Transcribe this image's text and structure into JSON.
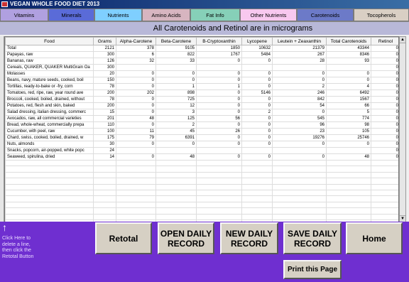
{
  "window": {
    "title": "VEGAN WHOLE FOOD DIET 2013"
  },
  "tabs": [
    {
      "label": "Vitamins",
      "color": "#b0a0e0"
    },
    {
      "label": "Minerals",
      "color": "#5a6bd8"
    },
    {
      "label": "Nutrients",
      "color": "#7fcfff"
    },
    {
      "label": "Amino Acids",
      "color": "#d7b5c0"
    },
    {
      "label": "Fat Info",
      "color": "#86d0b8"
    },
    {
      "label": "Other Nutrients",
      "color": "#f8c8ef"
    },
    {
      "label": "Carotenoids",
      "color": "#6c7ac8"
    },
    {
      "label": "Tocopherols",
      "color": "#d9cfc4"
    }
  ],
  "panel": {
    "heading": "All Carotenoids and Retinol are in micrograms"
  },
  "table": {
    "columns": [
      "Food",
      "Grams",
      "Alpha-Carotene",
      "Beta-Carotene",
      "B-Cryptoxanthin",
      "Lycopene",
      "Leutein + Zeaxanthin",
      "Total Carotenoids",
      "Retinol"
    ],
    "rows": [
      [
        "Total",
        "2121",
        "378",
        "9105",
        "1850",
        "10632",
        "21379",
        "43344",
        "0"
      ],
      [
        "Papayas, raw",
        "300",
        "6",
        "822",
        "1767",
        "5484",
        "267",
        "8346",
        "0"
      ],
      [
        "Bananas, raw",
        "126",
        "32",
        "33",
        "0",
        "0",
        "28",
        "93",
        "0"
      ],
      [
        "Cereals, QUAKER, QUAKER MultiGrain Oa",
        "300",
        "",
        "",
        "",
        "",
        "",
        "",
        "0"
      ],
      [
        "Molasses",
        "20",
        "0",
        "0",
        "0",
        "0",
        "0",
        "0",
        "0"
      ],
      [
        "Beans, navy, mature seeds, cooked, boil",
        "150",
        "0",
        "0",
        "0",
        "0",
        "0",
        "0",
        "0"
      ],
      [
        "Tortillas, ready-to-bake or -fry, corn",
        "78",
        "0",
        "1",
        "1",
        "0",
        "2",
        "4",
        "0"
      ],
      [
        "Tomatoes, red, ripe, raw, year round ave",
        "200",
        "202",
        "898",
        "0",
        "5146",
        "246",
        "6492",
        "0"
      ],
      [
        "Broccoli, cooked, boiled, drained, without",
        "78",
        "0",
        "725",
        "0",
        "0",
        "842",
        "1567",
        "0"
      ],
      [
        "Potatoes, red, flesh and skin, baked",
        "200",
        "0",
        "12",
        "0",
        "0",
        "54",
        "66",
        "0"
      ],
      [
        "Salad dressing, italian dressing, commerc",
        "15",
        "0",
        "3",
        "0",
        "2",
        "0",
        "5",
        "0"
      ],
      [
        "Avocados, raw, all commercial varieties",
        "201",
        "48",
        "125",
        "56",
        "0",
        "545",
        "774",
        "0"
      ],
      [
        "Bread, whole-wheat, commercially prepa",
        "110",
        "0",
        "2",
        "0",
        "0",
        "96",
        "98",
        "0"
      ],
      [
        "Cucumber, with peel, raw",
        "100",
        "11",
        "45",
        "26",
        "0",
        "23",
        "105",
        "0"
      ],
      [
        "Chard, swiss, cooked, boiled, drained, w",
        "175",
        "79",
        "6391",
        "0",
        "0",
        "19276",
        "25746",
        "0"
      ],
      [
        "Nuts, almonds",
        "30",
        "0",
        "0",
        "0",
        "0",
        "0",
        "0",
        "0"
      ],
      [
        "Snacks, popcorn, air-popped, white popc",
        "24",
        "",
        "",
        "",
        "",
        "",
        "",
        "0"
      ],
      [
        "Seaweed, spirulina, dried",
        "14",
        "0",
        "48",
        "0",
        "0",
        "0",
        "48",
        "0"
      ]
    ],
    "empty_rows": 12
  },
  "hint": "Click Here to delete a line, then click the Retotal Button",
  "buttons": {
    "retotal": "Retotal",
    "open_daily": "OPEN DAILY RECORD",
    "new_daily": "NEW DAILY RECORD",
    "save_daily": "SAVE DAILY RECORD",
    "home": "Home",
    "print": "Print this Page"
  },
  "colors": {
    "background": "#6f2fd0",
    "button": "#d6d0c4"
  }
}
